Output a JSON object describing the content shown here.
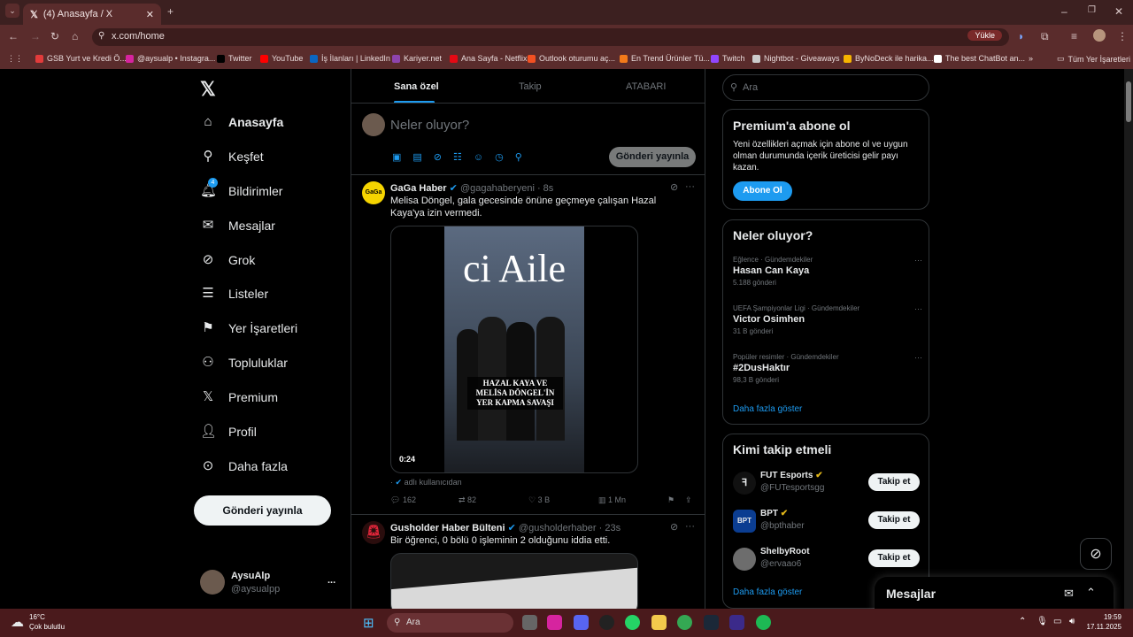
{
  "browser": {
    "tab_title": "(4) Anasayfa / X",
    "url": "x.com/home",
    "update_label": "Yükle"
  },
  "bookmarks": [
    "GSB Yurt ve Kredi Ö...",
    "@aysualp • Instagra...",
    "Twitter",
    "YouTube",
    "İş İlanları | LinkedIn",
    "Kariyer.net",
    "Ana Sayfa - Netflix",
    "Outlook oturumu aç...",
    "En Trend Ürünler Tü...",
    "Twitch",
    "Nightbot - Giveaways",
    "ByNoDeck ile harika...",
    "The best ChatBot an...",
    "Tüm Yer İşaretleri"
  ],
  "sidebar": {
    "items": [
      "Anasayfa",
      "Keşfet",
      "Bildirimler",
      "Mesajlar",
      "Grok",
      "Listeler",
      "Yer İşaretleri",
      "Topluluklar",
      "Premium",
      "Profil",
      "Daha fazla"
    ],
    "notif_count": "4",
    "post_button": "Gönderi yayınla",
    "user_name": "AysuAlp",
    "user_handle": "@aysualpp",
    "user_more": "..."
  },
  "feed": {
    "tabs": [
      "Sana özel",
      "Takip",
      "ATABARI"
    ],
    "compose_placeholder": "Neler oluyor?",
    "compose_button": "Gönderi yayınla",
    "post1": {
      "author": "GaGa Haber",
      "handle": "@gagahaberyeni",
      "time": "· 8s",
      "text": "Melisa Döngel, gala gecesinde önüne geçmeye çalışan Hazal Kaya'ya izin vermedi.",
      "media_title": "ci Aile",
      "media_caption": "HAZAL KAYA VE MELİSA DÖNGEL'İN YER KAPMA SAVAŞI",
      "duration": "0:24",
      "avatar_text": "GaGa",
      "source": "adlı kullanıcıdan",
      "replies": "162",
      "reposts": "82",
      "likes": "3 B",
      "views": "1 Mn"
    },
    "post2": {
      "author": "Gusholder Haber Bülteni",
      "handle": "@gusholderhaber",
      "time": "· 23s",
      "text": "Bir öğrenci, 0 bölü 0 işleminin 2 olduğunu iddia etti."
    }
  },
  "right": {
    "search_placeholder": "Ara",
    "premium": {
      "title": "Premium'a abone ol",
      "text": "Yeni özellikleri açmak için abone ol ve uygun olman durumunda içerik üreticisi gelir payı kazan.",
      "button": "Abone Ol"
    },
    "trends": {
      "title": "Neler oluyor?",
      "items": [
        {
          "context": "Eğlence · Gündemdekiler",
          "name": "Hasan Can Kaya",
          "count": "5.188 gönderi"
        },
        {
          "context": "UEFA Şampiyonlar Ligi · Gündemdekiler",
          "name": "Victor Osimhen",
          "count": "31 B gönderi"
        },
        {
          "context": "Popüler resimler · Gündemdekiler",
          "name": "#2DusHaktır",
          "count": "98,3 B gönderi"
        }
      ],
      "more": "Daha fazla göster"
    },
    "follow": {
      "title": "Kimi takip etmeli",
      "items": [
        {
          "name": "FUT Esports",
          "handle": "@FUTesportsgg"
        },
        {
          "name": "BPT",
          "handle": "@bpthaber"
        },
        {
          "name": "ShelbyRoot",
          "handle": "@ervaao6"
        }
      ],
      "button": "Takip et",
      "more": "Daha fazla göster"
    },
    "messages": "Mesajlar"
  },
  "taskbar": {
    "temp": "16°C",
    "weather": "Çok bulutlu",
    "search": "Ara",
    "time": "19:59",
    "date": "17.11.2025"
  }
}
